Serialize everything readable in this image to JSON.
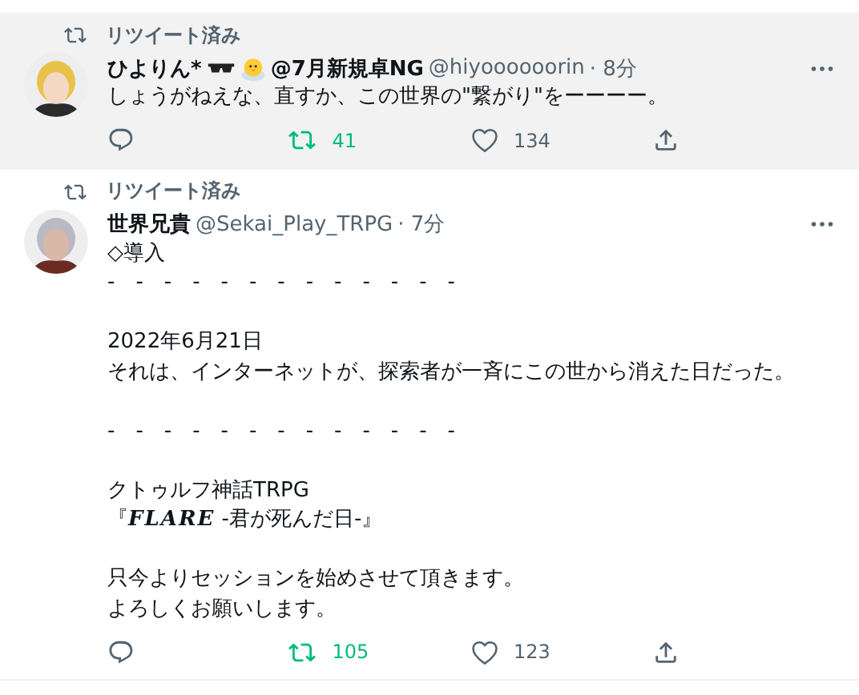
{
  "tweets": [
    {
      "highlighted": true,
      "retweet_label": "リツイート済み",
      "avatar": {
        "kind": "picture"
      },
      "name_parts": [
        {
          "kind": "text",
          "text": "ひよりん*"
        },
        {
          "kind": "sunglasses"
        },
        {
          "kind": "chick"
        },
        {
          "kind": "text",
          "text": "@7月新規卓NG"
        }
      ],
      "handle": "@hiyoooooorin",
      "time": "· 8分",
      "paragraphs": [
        [
          "しょうがねえな、直すか、この世界の\"繋がり\"をーーーー。"
        ]
      ],
      "retweets": "41",
      "retweeted": true,
      "likes": "134",
      "liked": false
    },
    {
      "highlighted": false,
      "retweet_label": "リツイート済み",
      "avatar": {
        "kind": "picture"
      },
      "name_parts": [
        {
          "kind": "text",
          "text": "世界兄貴"
        }
      ],
      "handle": "@Sekai_Play_TRPG",
      "time": "· 7分",
      "paragraphs": [
        [
          "◇導入",
          "-　-　-　-　-　-　-　-　-　-　-　-　-"
        ],
        [
          "2022年6月21日",
          "それは、インターネットが、探索者が一斉にこの世から消えた日だった。"
        ],
        [
          "-　-　-　-　-　-　-　-　-　-　-　-　-"
        ],
        [
          "クトゥルフ神話TRPG",
          "『**FLARE** -君が死んだ日-』"
        ],
        [
          "只今よりセッションを始めさせて頂きます。",
          "よろしくお願いします。"
        ]
      ],
      "retweets": "105",
      "retweeted": true,
      "likes": "123",
      "liked": false
    }
  ]
}
